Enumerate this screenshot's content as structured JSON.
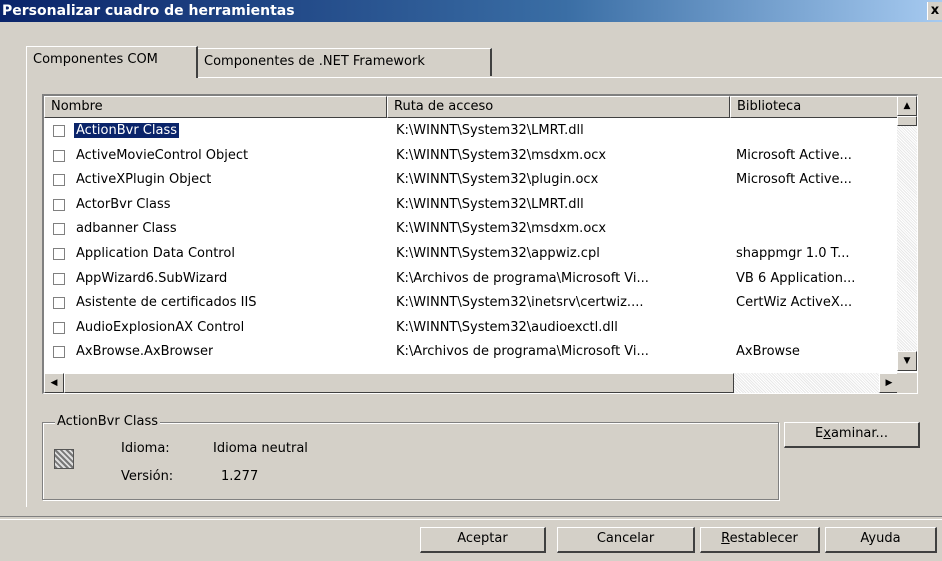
{
  "window": {
    "title": "Personalizar cuadro de herramientas",
    "close_glyph": "x"
  },
  "tabs": [
    {
      "label": "Componentes COM",
      "active": true
    },
    {
      "label": "Componentes de .NET Framework",
      "active": false
    }
  ],
  "list": {
    "columns": [
      "Nombre",
      "Ruta de acceso",
      "Biblioteca"
    ],
    "rows": [
      {
        "name": "ActionBvr Class",
        "path": "K:\\WINNT\\System32\\LMRT.dll",
        "lib": "",
        "selected": true
      },
      {
        "name": "ActiveMovieControl Object",
        "path": "K:\\WINNT\\System32\\msdxm.ocx",
        "lib": "Microsoft Active..."
      },
      {
        "name": "ActiveXPlugin Object",
        "path": "K:\\WINNT\\System32\\plugin.ocx",
        "lib": "Microsoft Active..."
      },
      {
        "name": "ActorBvr Class",
        "path": "K:\\WINNT\\System32\\LMRT.dll",
        "lib": ""
      },
      {
        "name": "adbanner Class",
        "path": "K:\\WINNT\\System32\\msdxm.ocx",
        "lib": ""
      },
      {
        "name": "Application Data Control",
        "path": "K:\\WINNT\\System32\\appwiz.cpl",
        "lib": "shappmgr 1.0 T..."
      },
      {
        "name": "AppWizard6.SubWizard",
        "path": "K:\\Archivos de programa\\Microsoft Vi...",
        "lib": "VB 6 Application..."
      },
      {
        "name": "Asistente de certificados IIS",
        "path": "K:\\WINNT\\System32\\inetsrv\\certwiz....",
        "lib": "CertWiz ActiveX..."
      },
      {
        "name": "AudioExplosionAX Control",
        "path": "K:\\WINNT\\System32\\audioexctl.dll",
        "lib": ""
      },
      {
        "name": "AxBrowse.AxBrowser",
        "path": "K:\\Archivos de programa\\Microsoft Vi...",
        "lib": "AxBrowse"
      }
    ]
  },
  "details": {
    "group_title": "ActionBvr Class",
    "language_label": "Idioma:",
    "language_value": "Idioma neutral",
    "version_label": "Versión:",
    "version_value": "1.277"
  },
  "buttons": {
    "browse": {
      "prefix": "E",
      "underline": "x",
      "rest": "aminar..."
    },
    "accept": "Aceptar",
    "cancel": "Cancelar",
    "reset": {
      "underline": "R",
      "rest": "establecer"
    },
    "help": "Ayuda"
  },
  "icons": {
    "title_close": "close-icon",
    "scroll_up": "triangle-up-icon",
    "scroll_down": "triangle-down-icon",
    "scroll_left": "triangle-left-icon",
    "scroll_right": "triangle-right-icon",
    "component": "component-icon"
  }
}
